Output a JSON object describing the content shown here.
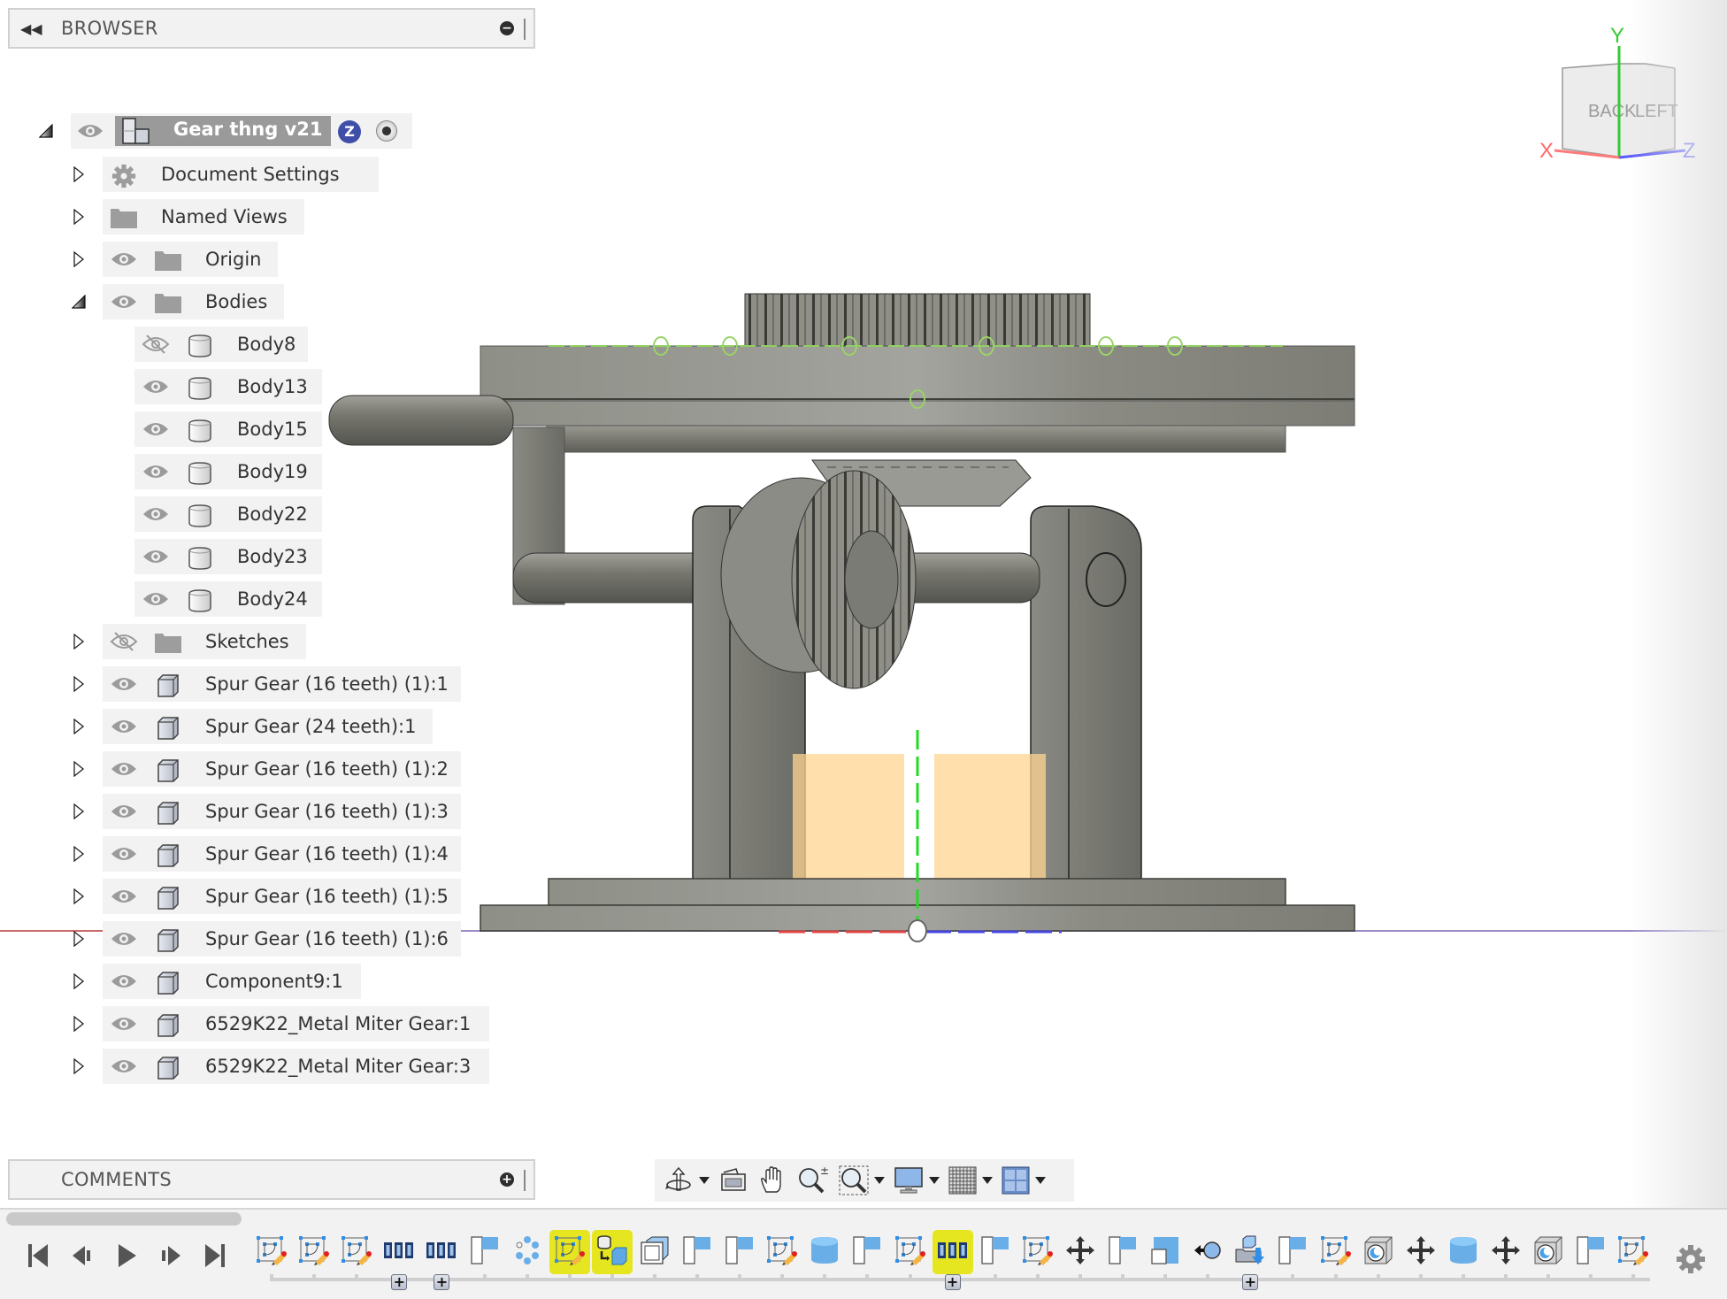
{
  "browser": {
    "title": "BROWSER",
    "collapse_icon": "double-chevron-left-icon",
    "root": {
      "label": "Gear thng v21",
      "badge": "Z",
      "icon": "component-icon"
    },
    "items": [
      {
        "label": "Document Settings",
        "icon": "gear-icon",
        "visible": null,
        "expanded": false,
        "level": 1
      },
      {
        "label": "Named Views",
        "icon": "folder-icon",
        "visible": null,
        "expanded": false,
        "level": 1
      },
      {
        "label": "Origin",
        "icon": "folder-icon",
        "visible": true,
        "expanded": false,
        "level": 1
      },
      {
        "label": "Bodies",
        "icon": "folder-icon",
        "visible": true,
        "expanded": true,
        "level": 1
      },
      {
        "label": "Body8",
        "icon": "body-icon",
        "visible": false,
        "level": 2
      },
      {
        "label": "Body13",
        "icon": "body-icon",
        "visible": true,
        "level": 2
      },
      {
        "label": "Body15",
        "icon": "body-icon",
        "visible": true,
        "level": 2
      },
      {
        "label": "Body19",
        "icon": "body-icon",
        "visible": true,
        "level": 2
      },
      {
        "label": "Body22",
        "icon": "body-icon",
        "visible": true,
        "level": 2
      },
      {
        "label": "Body23",
        "icon": "body-icon",
        "visible": true,
        "level": 2
      },
      {
        "label": "Body24",
        "icon": "body-icon",
        "visible": true,
        "level": 2
      },
      {
        "label": "Sketches",
        "icon": "folder-icon",
        "visible": false,
        "expanded": false,
        "level": 1
      },
      {
        "label": "Spur Gear (16 teeth) (1):1",
        "icon": "component-box-icon",
        "visible": true,
        "expanded": false,
        "level": 1
      },
      {
        "label": "Spur Gear (24 teeth):1",
        "icon": "component-box-icon",
        "visible": true,
        "expanded": false,
        "level": 1
      },
      {
        "label": "Spur Gear (16 teeth) (1):2",
        "icon": "component-box-icon",
        "visible": true,
        "expanded": false,
        "level": 1
      },
      {
        "label": "Spur Gear (16 teeth) (1):3",
        "icon": "component-box-icon",
        "visible": true,
        "expanded": false,
        "level": 1
      },
      {
        "label": "Spur Gear (16 teeth) (1):4",
        "icon": "component-box-icon",
        "visible": true,
        "expanded": false,
        "level": 1
      },
      {
        "label": "Spur Gear (16 teeth) (1):5",
        "icon": "component-box-icon",
        "visible": true,
        "expanded": false,
        "level": 1
      },
      {
        "label": "Spur Gear (16 teeth) (1):6",
        "icon": "component-box-icon",
        "visible": true,
        "expanded": false,
        "level": 1
      },
      {
        "label": "Component9:1",
        "icon": "component-box-icon",
        "visible": true,
        "expanded": false,
        "level": 1
      },
      {
        "label": "6529K22_Metal Miter Gear:1",
        "icon": "component-box-icon",
        "visible": true,
        "expanded": false,
        "level": 1
      },
      {
        "label": "6529K22_Metal Miter Gear:3",
        "icon": "component-box-icon",
        "visible": true,
        "expanded": false,
        "level": 1
      }
    ]
  },
  "comments": {
    "title": "COMMENTS"
  },
  "viewcube": {
    "face_left": "BACK",
    "face_right": "LEFT",
    "axis_x": "X",
    "axis_y": "Y",
    "axis_z": "Z"
  },
  "colors": {
    "axis_x": "#ff6b6b",
    "axis_y": "#33cc33",
    "axis_z": "#5a5aff",
    "timeline_highlight": "#e6e620",
    "model_gray": "#8a8a84",
    "selection_orange": "#ffd591"
  },
  "nav_toolbar": [
    {
      "name": "orbit",
      "icon": "orbit-icon",
      "dropdown": true
    },
    {
      "name": "look-at",
      "icon": "look-at-icon",
      "dropdown": false
    },
    {
      "name": "pan",
      "icon": "hand-pan-icon",
      "dropdown": false
    },
    {
      "name": "zoom",
      "icon": "zoom-icon",
      "dropdown": false
    },
    {
      "name": "fit",
      "icon": "zoom-window-icon",
      "dropdown": true
    },
    {
      "name": "display-settings",
      "icon": "monitor-icon",
      "dropdown": true
    },
    {
      "name": "grid-settings",
      "icon": "grid-icon",
      "dropdown": true
    },
    {
      "name": "viewports",
      "icon": "viewports-icon",
      "dropdown": true
    }
  ],
  "playback": [
    {
      "name": "go-to-start",
      "icon": "skip-start-icon"
    },
    {
      "name": "step-back",
      "icon": "step-back-icon"
    },
    {
      "name": "play",
      "icon": "play-icon"
    },
    {
      "name": "step-forward",
      "icon": "step-forward-icon"
    },
    {
      "name": "go-to-end",
      "icon": "skip-end-icon"
    }
  ],
  "timeline": [
    {
      "type": "sketch"
    },
    {
      "type": "sketch"
    },
    {
      "type": "sketch"
    },
    {
      "type": "pattern",
      "group": true
    },
    {
      "type": "pattern",
      "group": true
    },
    {
      "type": "extrude"
    },
    {
      "type": "circular-pattern"
    },
    {
      "type": "sketch",
      "highlighted": true
    },
    {
      "type": "derive",
      "highlighted": true
    },
    {
      "type": "shell"
    },
    {
      "type": "extrude"
    },
    {
      "type": "extrude"
    },
    {
      "type": "sketch"
    },
    {
      "type": "cylinder"
    },
    {
      "type": "extrude"
    },
    {
      "type": "sketch"
    },
    {
      "type": "pattern",
      "group": true,
      "highlighted": true
    },
    {
      "type": "extrude"
    },
    {
      "type": "sketch"
    },
    {
      "type": "move"
    },
    {
      "type": "extrude"
    },
    {
      "type": "combine"
    },
    {
      "type": "joint"
    },
    {
      "type": "insert",
      "group": true
    },
    {
      "type": "extrude"
    },
    {
      "type": "sketch"
    },
    {
      "type": "hole"
    },
    {
      "type": "move"
    },
    {
      "type": "cylinder"
    },
    {
      "type": "move"
    },
    {
      "type": "hole"
    },
    {
      "type": "extrude"
    },
    {
      "type": "sketch"
    }
  ]
}
